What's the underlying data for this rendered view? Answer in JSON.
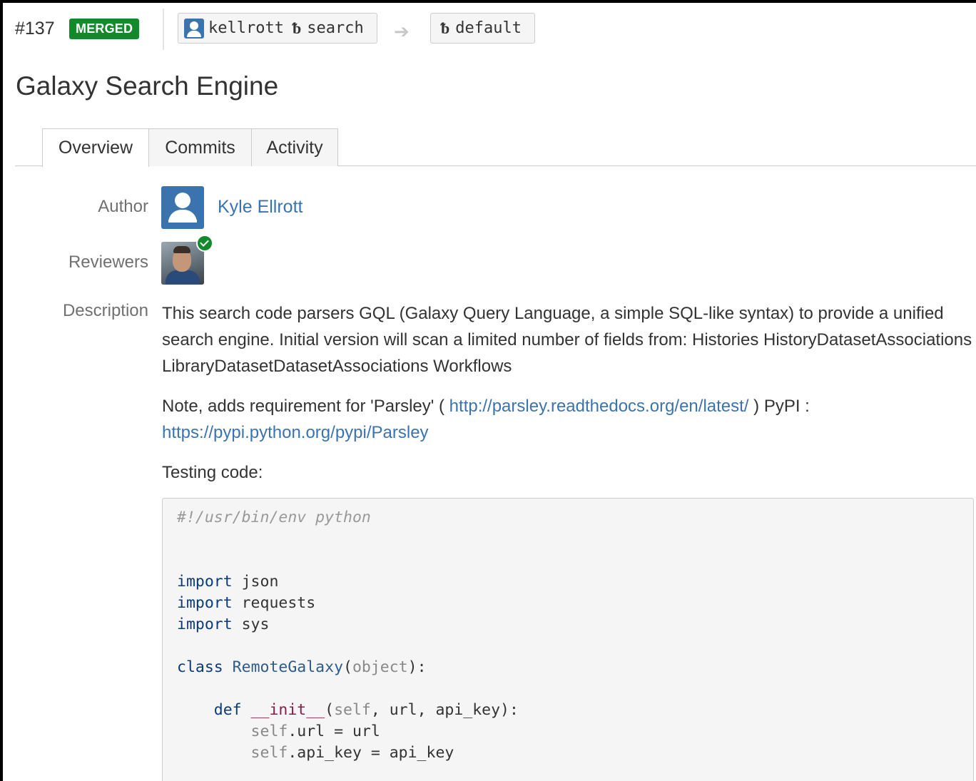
{
  "header": {
    "pr_number": "#137",
    "status_badge": "MERGED",
    "source_user": "kellrott",
    "source_branch": "search",
    "target_branch": "default",
    "arrow": "➔"
  },
  "title": "Galaxy Search Engine",
  "tabs": [
    {
      "label": "Overview",
      "active": true
    },
    {
      "label": "Commits",
      "active": false
    },
    {
      "label": "Activity",
      "active": false
    }
  ],
  "fields": {
    "author_label": "Author",
    "author_name": "Kyle Ellrott",
    "reviewers_label": "Reviewers",
    "description_label": "Description"
  },
  "description": {
    "paragraph1": "This search code parsers GQL (Galaxy Query Language, a simple SQL-like syntax) to provide a unified search engine. Initial version will scan a limited number of fields from: Histories HistoryDatasetAssociations LibraryDatasetDatasetAssociations Workflows",
    "note_prefix": "Note, adds requirement for 'Parsley' ( ",
    "link1": "http://parsley.readthedocs.org/en/latest/",
    "note_mid": " ) PyPI : ",
    "link2": "https://pypi.python.org/pypi/Parsley",
    "testing": "Testing code:"
  },
  "code": {
    "shebang": "#!/usr/bin/env python",
    "import1_kw": "import",
    "import1_mod": " json",
    "import2_kw": "import",
    "import2_mod": " requests",
    "import3_kw": "import",
    "import3_mod": " sys",
    "class_kw": "class",
    "class_name": " RemoteGalaxy",
    "class_paren_open": "(",
    "class_base": "object",
    "class_paren_close": "):",
    "def_kw": "    def",
    "def_name": " __init__",
    "def_paren": "(",
    "def_self": "self",
    "def_args": ", url, api_key):",
    "line1_self": "        self",
    "line1_rest": ".url = url",
    "line2_self": "        self",
    "line2_rest": ".api_key = api_key"
  },
  "colors": {
    "link": "#3b73af",
    "merged": "#14892c"
  }
}
